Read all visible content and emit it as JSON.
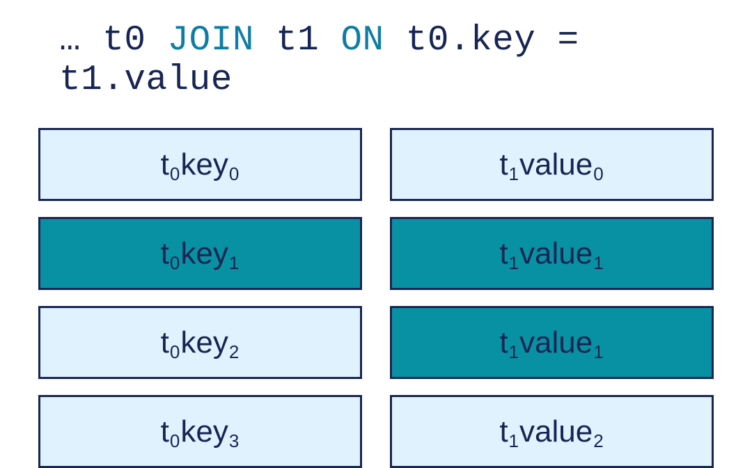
{
  "heading": {
    "ellipsis": "…",
    "t0": "t0",
    "join": "JOIN",
    "t1": "t1",
    "on": "ON",
    "lhs": "t0.key",
    "eq": "=",
    "rhs": "t1.value"
  },
  "rows": [
    {
      "left": {
        "prefix": "t",
        "prefixSub": "0",
        "name": "key",
        "nameSub": "0",
        "highlight": false
      },
      "right": {
        "prefix": "t",
        "prefixSub": "1",
        "name": "value",
        "nameSub": "0",
        "highlight": false
      }
    },
    {
      "left": {
        "prefix": "t",
        "prefixSub": "0",
        "name": "key",
        "nameSub": "1",
        "highlight": true
      },
      "right": {
        "prefix": "t",
        "prefixSub": "1",
        "name": "value",
        "nameSub": "1",
        "highlight": true
      }
    },
    {
      "left": {
        "prefix": "t",
        "prefixSub": "0",
        "name": "key",
        "nameSub": "2",
        "highlight": false
      },
      "right": {
        "prefix": "t",
        "prefixSub": "1",
        "name": "value",
        "nameSub": "1",
        "highlight": true
      }
    },
    {
      "left": {
        "prefix": "t",
        "prefixSub": "0",
        "name": "key",
        "nameSub": "3",
        "highlight": false
      },
      "right": {
        "prefix": "t",
        "prefixSub": "1",
        "name": "value",
        "nameSub": "2",
        "highlight": false
      }
    }
  ],
  "colors": {
    "light": "#e0f2fe",
    "dark": "#0891a2",
    "border": "#172554",
    "keyword": "#0e7da6"
  }
}
